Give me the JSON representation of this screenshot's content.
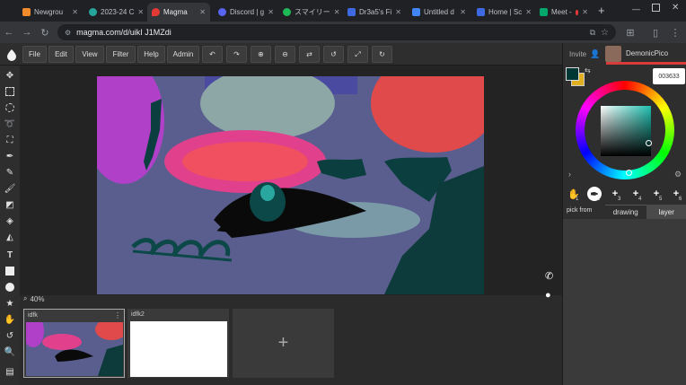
{
  "browser": {
    "tabs": [
      {
        "label": "Newgrou",
        "color": "#f28b2a",
        "active": false
      },
      {
        "label": "2023-24 C",
        "color": "#26a69a",
        "active": false
      },
      {
        "label": "Magma",
        "color": "#e53935",
        "active": true
      },
      {
        "label": "Discord | g",
        "color": "#5865f2",
        "active": false
      },
      {
        "label": "スマイリー",
        "color": "#1db954",
        "active": false
      },
      {
        "label": "Dr3a5's Fi",
        "color": "#3d6ae0",
        "active": false
      },
      {
        "label": "Untitled d",
        "color": "#4285f4",
        "active": false
      },
      {
        "label": "Home | Sc",
        "color": "#3d6ae0",
        "active": false
      },
      {
        "label": "Meet -",
        "color": "#00a86b",
        "active": false
      }
    ],
    "url": "magma.com/d/uikI J1MZdi",
    "new_tab": "+"
  },
  "menu": {
    "items": [
      "File",
      "Edit",
      "View",
      "Filter",
      "Help",
      "Admin"
    ]
  },
  "panel": {
    "invite": "Invite",
    "username": "DemonicPico",
    "hex": "003633",
    "primary_color": "#003633",
    "secondary_color": "#e0b020",
    "pick_from": "pick from",
    "tab_drawing": "drawing",
    "tab_layer": "layer",
    "slot_numbers": [
      "1",
      "2",
      "3",
      "4",
      "5",
      "6"
    ]
  },
  "canvas": {
    "zoom": "40%"
  },
  "documents": [
    {
      "name": "idfk"
    },
    {
      "name": "idfk2"
    }
  ],
  "add_document": "+"
}
